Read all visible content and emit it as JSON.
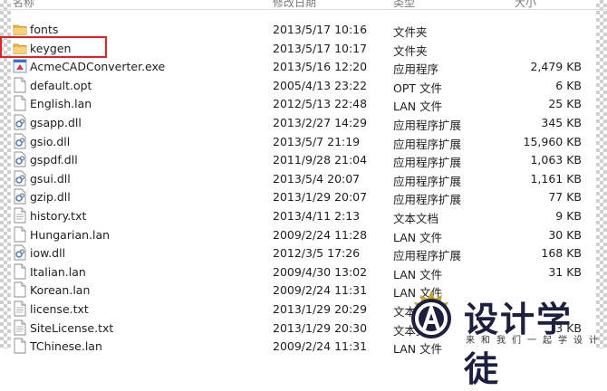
{
  "header": {
    "name": "名称",
    "date": "修改日期",
    "type": "类型",
    "size": "大小"
  },
  "files": [
    {
      "name": "fonts",
      "date": "2013/5/17 10:16",
      "type": "文件夹",
      "size": "",
      "icon": "folder-icon"
    },
    {
      "name": "keygen",
      "date": "2013/5/17 10:17",
      "type": "文件夹",
      "size": "",
      "icon": "folder-icon"
    },
    {
      "name": "AcmeCADConverter.exe",
      "date": "2013/5/16 12:20",
      "type": "应用程序",
      "size": "2,479 KB",
      "icon": "exe-icon"
    },
    {
      "name": "default.opt",
      "date": "2005/4/13 23:22",
      "type": "OPT 文件",
      "size": "6 KB",
      "icon": "file-icon"
    },
    {
      "name": "English.lan",
      "date": "2012/5/13 22:48",
      "type": "LAN 文件",
      "size": "25 KB",
      "icon": "file-icon"
    },
    {
      "name": "gsapp.dll",
      "date": "2013/2/27 14:29",
      "type": "应用程序扩展",
      "size": "345 KB",
      "icon": "dll-icon"
    },
    {
      "name": "gsio.dll",
      "date": "2013/5/7 21:19",
      "type": "应用程序扩展",
      "size": "15,960 KB",
      "icon": "dll-icon"
    },
    {
      "name": "gspdf.dll",
      "date": "2011/9/28 21:04",
      "type": "应用程序扩展",
      "size": "1,063 KB",
      "icon": "dll-icon"
    },
    {
      "name": "gsui.dll",
      "date": "2013/5/4 20:07",
      "type": "应用程序扩展",
      "size": "1,161 KB",
      "icon": "dll-icon"
    },
    {
      "name": "gzip.dll",
      "date": "2013/1/29 20:07",
      "type": "应用程序扩展",
      "size": "77 KB",
      "icon": "dll-icon"
    },
    {
      "name": "history.txt",
      "date": "2013/4/11 2:13",
      "type": "文本文档",
      "size": "9 KB",
      "icon": "txt-icon"
    },
    {
      "name": "Hungarian.lan",
      "date": "2009/2/24 11:28",
      "type": "LAN 文件",
      "size": "30 KB",
      "icon": "file-icon"
    },
    {
      "name": "iow.dll",
      "date": "2012/3/5 17:26",
      "type": "应用程序扩展",
      "size": "168 KB",
      "icon": "dll-icon"
    },
    {
      "name": "Italian.lan",
      "date": "2009/4/30 13:02",
      "type": "LAN 文件",
      "size": "31 KB",
      "icon": "file-icon"
    },
    {
      "name": "Korean.lan",
      "date": "2009/2/24 11:31",
      "type": "LAN 文件",
      "size": "",
      "icon": "file-icon"
    },
    {
      "name": "license.txt",
      "date": "2013/1/29 20:29",
      "type": "文本文档",
      "size": "",
      "icon": "txt-icon"
    },
    {
      "name": "SiteLicense.txt",
      "date": "2013/1/29 20:30",
      "type": "文本文档",
      "size": "3 KB",
      "icon": "txt-icon"
    },
    {
      "name": "TChinese.lan",
      "date": "2009/2/24 11:31",
      "type": "LAN 文件",
      "size": "",
      "icon": "file-icon"
    }
  ],
  "watermark": {
    "title": "设计学徒",
    "subtitle": "来和我们一起学设计",
    "color": "#1d1f3e",
    "accent": "#c9a227"
  },
  "highlight_color": "#e02424"
}
